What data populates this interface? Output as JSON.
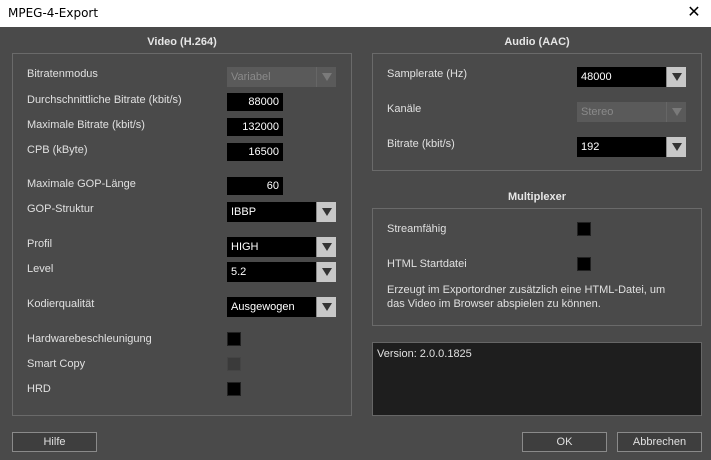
{
  "window": {
    "title": "MPEG-4-Export",
    "close_glyph": "✕"
  },
  "video": {
    "title": "Video (H.264)",
    "bitrate_mode": {
      "label": "Bitratenmodus",
      "value": "Variabel"
    },
    "avg_bitrate": {
      "label": "Durchschnittliche Bitrate (kbit/s)",
      "value": "88000"
    },
    "max_bitrate": {
      "label": "Maximale Bitrate (kbit/s)",
      "value": "132000"
    },
    "cpb": {
      "label": "CPB (kByte)",
      "value": "16500"
    },
    "gop_length": {
      "label": "Maximale GOP-Länge",
      "value": "60"
    },
    "gop_structure": {
      "label": "GOP-Struktur",
      "value": "IBBP"
    },
    "profile": {
      "label": "Profil",
      "value": "HIGH"
    },
    "level": {
      "label": "Level",
      "value": "5.2"
    },
    "quality": {
      "label": "Kodierqualität",
      "value": "Ausgewogen"
    },
    "hw_accel": {
      "label": "Hardwarebeschleunigung"
    },
    "smart_copy": {
      "label": "Smart Copy"
    },
    "hrd": {
      "label": "HRD"
    }
  },
  "audio": {
    "title": "Audio (AAC)",
    "samplerate": {
      "label": "Samplerate (Hz)",
      "value": "48000"
    },
    "channels": {
      "label": "Kanäle",
      "value": "Stereo"
    },
    "bitrate": {
      "label": "Bitrate (kbit/s)",
      "value": "192"
    }
  },
  "multiplexer": {
    "title": "Multiplexer",
    "streamable": {
      "label": "Streamfähig"
    },
    "html_start": {
      "label": "HTML Startdatei"
    },
    "info_line1": "Erzeugt im Exportordner zusätzlich eine HTML-Datei, um",
    "info_line2": "das Video im Browser abspielen zu können."
  },
  "version": "Version: 2.0.0.1825",
  "buttons": {
    "help": "Hilfe",
    "ok": "OK",
    "cancel": "Abbrechen"
  }
}
